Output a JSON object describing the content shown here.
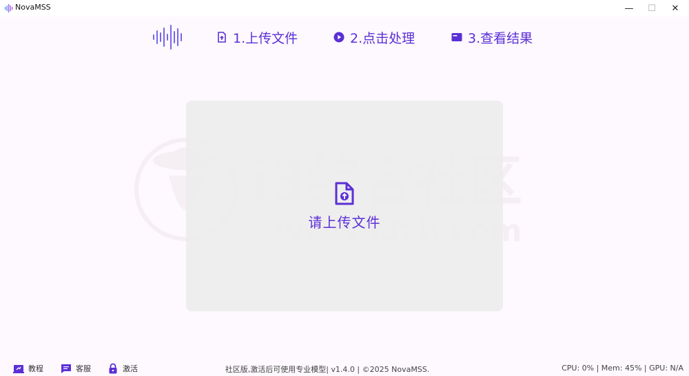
{
  "window": {
    "title": "NovaMSS",
    "minimize_glyph": "—",
    "maximize_glyph": "☐",
    "close_glyph": "✕"
  },
  "steps": [
    {
      "label": "1.上传文件",
      "icon": "file-upload-icon"
    },
    {
      "label": "2.点击处理",
      "icon": "play-circle-icon"
    },
    {
      "label": "3.查看结果",
      "icon": "window-result-icon"
    }
  ],
  "upload": {
    "label": "请上传文件",
    "icon": "file-upload-icon"
  },
  "watermark": {
    "text": "i3综合社区",
    "url_text": "www.i3zh.com"
  },
  "footer": {
    "tutorial": "教程",
    "service": "客服",
    "activate": "激活",
    "center_text": "社区版,激活后可使用专业模型| v1.4.0 | ©2025 NovaMSS.",
    "status_text": "CPU: 0% | Mem: 45% | GPU: N/A"
  },
  "colors": {
    "accent": "#5b2fd6",
    "background": "#fdf9fe",
    "upload_bg": "#ececec"
  }
}
